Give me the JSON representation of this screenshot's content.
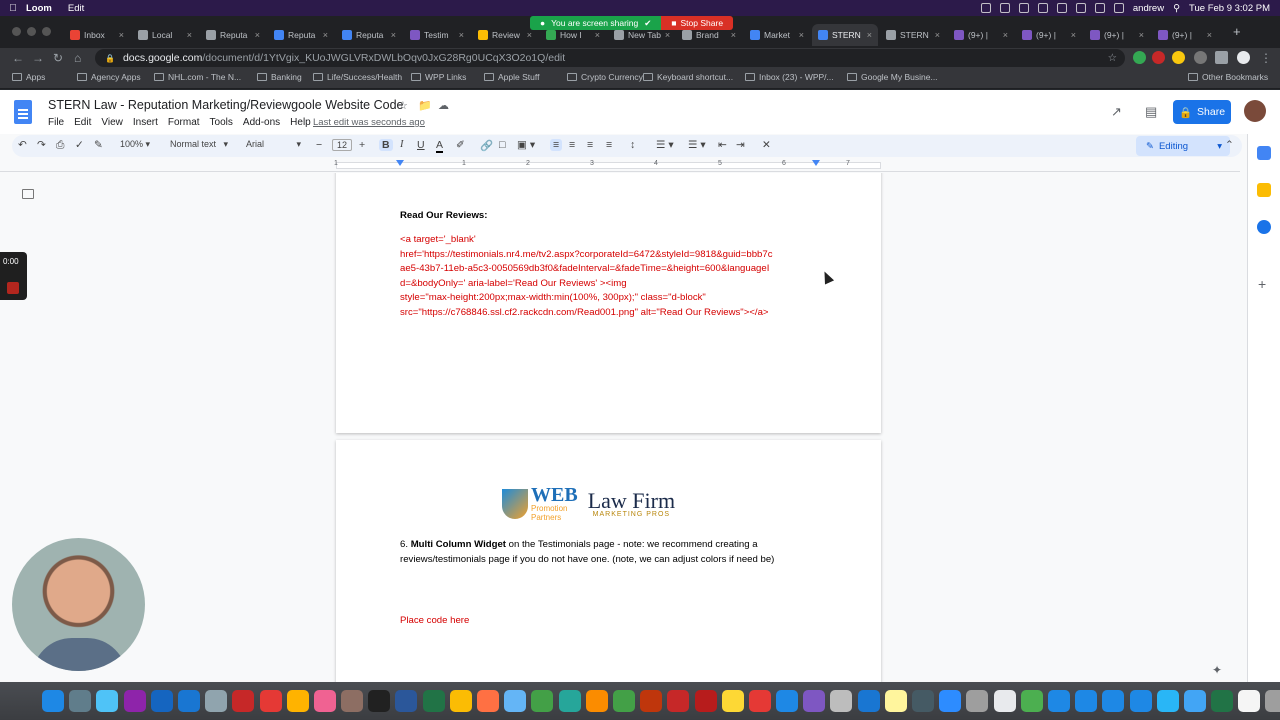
{
  "menubar": {
    "app": "Loom",
    "menu_edit": "Edit",
    "user": "andrew",
    "datetime": "Tue Feb 9  3:02 PM"
  },
  "screen_share": {
    "status": "You are screen sharing",
    "stop_label": "Stop Share"
  },
  "browser": {
    "tabs": [
      {
        "label": "Inbox",
        "color": "#ea4335"
      },
      {
        "label": "Local",
        "color": "#9aa0a6"
      },
      {
        "label": "Reputa",
        "color": "#9aa0a6"
      },
      {
        "label": "Reputa",
        "color": "#4285f4"
      },
      {
        "label": "Reputa",
        "color": "#4285f4"
      },
      {
        "label": "Testim",
        "color": "#7e57c2"
      },
      {
        "label": "Review",
        "color": "#fbbc04"
      },
      {
        "label": "How I",
        "color": "#34a853"
      },
      {
        "label": "New Tab",
        "color": "#9aa0a6"
      },
      {
        "label": "Brand",
        "color": "#9aa0a6"
      },
      {
        "label": "Market",
        "color": "#4285f4"
      },
      {
        "label": "STERN",
        "color": "#4285f4"
      },
      {
        "label": "STERN",
        "color": "#9aa0a6"
      },
      {
        "label": "(9+) |",
        "color": "#7e57c2"
      },
      {
        "label": "(9+) |",
        "color": "#7e57c2"
      },
      {
        "label": "(9+) |",
        "color": "#7e57c2"
      },
      {
        "label": "(9+) |",
        "color": "#7e57c2"
      }
    ],
    "new_tab_label": "+",
    "url_host": "docs.google.com",
    "url_path": "/document/d/1YtVgix_KUoJWGLVRxDWLbOqv0JxG28Rg0UCqX3O2o1Q/edit"
  },
  "bookmarks": {
    "items": [
      "Apps",
      "Agency Apps",
      "NHL.com - The N...",
      "Banking",
      "Life/Success/Health",
      "WPP Links",
      "Apple Stuff",
      "Crypto Currency",
      "Keyboard shortcut...",
      "Inbox (23) - WPP/...",
      "Google My Busine..."
    ],
    "other": "Other Bookmarks"
  },
  "docs": {
    "title": "STERN Law - Reputation Marketing/Reviewgoole Website Code",
    "menus": [
      "File",
      "Edit",
      "View",
      "Insert",
      "Format",
      "Tools",
      "Add-ons",
      "Help"
    ],
    "last_edit": "Last edit was seconds ago",
    "share_label": "Share",
    "zoom": "100%",
    "style": "Normal text",
    "font": "Arial",
    "font_size": "12",
    "mode": "Editing",
    "ruler_numbers": [
      "1",
      "1",
      "2",
      "3",
      "4",
      "5",
      "6",
      "7"
    ]
  },
  "document": {
    "section_heading": "Read Our Reviews:",
    "code_lines": [
      "<a target='_blank'",
      "href='https://testimonials.nr4.me/tv2.aspx?corporateId=6472&styleId=9818&guid=bbb7c",
      "ae5-43b7-11eb-a5c3-0050569db3f0&fadeInterval=&fadeTime=&height=600&languageI",
      "d=&bodyOnly=' aria-label='Read Our Reviews' ><img",
      "style=\"max-height:200px;max-width:min(100%, 300px);\" class=\"d-block\"",
      "src=\"https://c768846.ssl.cf2.rackcdn.com/Read001.png\" alt=\"Read Our Reviews\"></a>"
    ],
    "logo_left_big": "WEB",
    "logo_left_small1": "Promotion",
    "logo_left_small2": "Partners",
    "logo_right_big": "Law Firm",
    "logo_right_sub": "MARKETING PROS",
    "item_number": "6.",
    "item_bold": "Multi Column Widget",
    "item_rest": " on the Testimonials page - note: we recommend creating  a reviews/testimonials page if you do not have one. (note, we can adjust colors if need be)",
    "placeholder": "Place code here"
  },
  "loom": {
    "timer": "0:00"
  },
  "colors": {
    "accent": "#1a73e8",
    "code_red": "#d50000"
  }
}
